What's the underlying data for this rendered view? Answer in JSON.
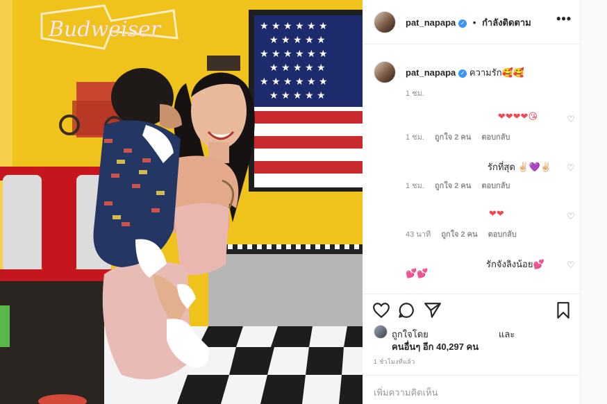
{
  "post": {
    "username": "pat_napapa",
    "follow_status": "กำลังติดตาม",
    "more_glyph": "•••",
    "separator": "•"
  },
  "photo": {
    "neon_sign": "Budweiser"
  },
  "caption": {
    "username": "pat_napapa",
    "text": "ความรัก🥰🥰",
    "time": "1 ชม."
  },
  "comments": [
    {
      "text": "❤❤❤❤😘",
      "time": "1 ชม.",
      "likes": "ถูกใจ 2 คน",
      "reply": "ตอบกลับ"
    },
    {
      "text": "รักที่สุด ✌🏻💜✌🏻",
      "time": "1 ชม.",
      "likes": "ถูกใจ 2 คน",
      "reply": "ตอบกลับ"
    },
    {
      "text": "❤❤",
      "time": "43 นาที",
      "likes": "ถูกใจ 2 คน",
      "reply": "ตอบกลับ"
    },
    {
      "text": "รักจังลิงน้อย💕",
      "text2": "💕💕"
    }
  ],
  "liked_by": {
    "prefix": "ถูกใจโดย",
    "and": "และ",
    "others": "คนอื่นๆ อีก 40,297 คน"
  },
  "posted_time": "1 ชั่วโมงที่แล้ว",
  "add_comment_placeholder": "เพิ่มความคิดเห็น",
  "icons": {
    "verified": "verified-badge-icon",
    "like": "heart-outline-icon",
    "comment": "speech-bubble-icon",
    "share": "paper-plane-icon",
    "save": "bookmark-icon"
  },
  "colors": {
    "verified_blue": "#3897f0",
    "wall_yellow": "#f2c21a",
    "muted_text": "#8e8e8e"
  }
}
